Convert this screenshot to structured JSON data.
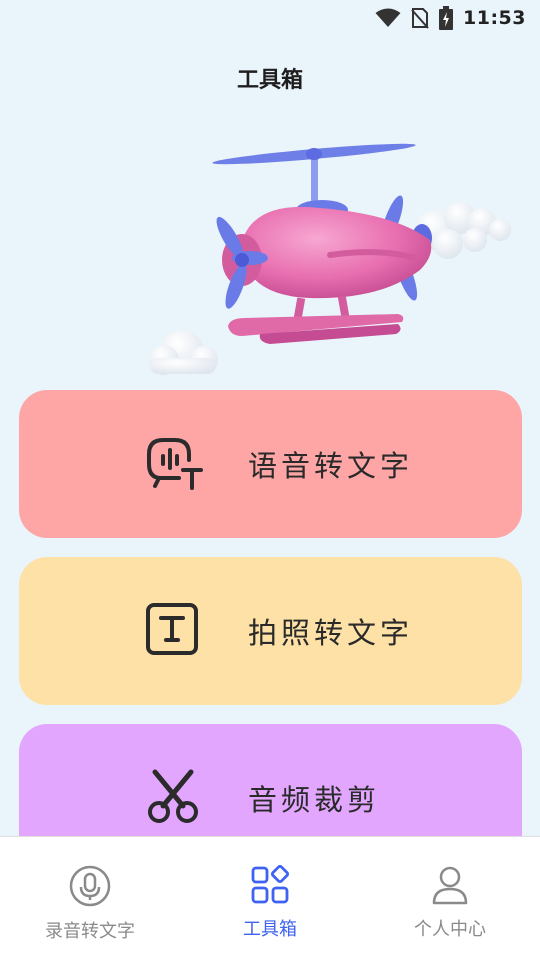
{
  "status_bar": {
    "time": "11:53",
    "icons": [
      "wifi-icon",
      "no-sim-icon",
      "battery-charging-icon"
    ]
  },
  "header": {
    "title": "工具箱"
  },
  "hero": {
    "image": "pink-helicopter-illustration"
  },
  "tools": [
    {
      "label": "语音转文字",
      "icon": "speech-to-text-icon",
      "color": "#fea6a6"
    },
    {
      "label": "拍照转文字",
      "icon": "text-box-icon",
      "color": "#fee1a6"
    },
    {
      "label": "音频裁剪",
      "icon": "scissors-icon",
      "color": "#e2a6fe"
    }
  ],
  "nav": {
    "items": [
      {
        "label": "录音转文字",
        "icon": "microphone-icon",
        "active": false
      },
      {
        "label": "工具箱",
        "icon": "grid-icon",
        "active": true
      },
      {
        "label": "个人中心",
        "icon": "person-icon",
        "active": false
      }
    ],
    "active_color": "#3f63f0",
    "inactive_color": "#8a8a8a"
  }
}
